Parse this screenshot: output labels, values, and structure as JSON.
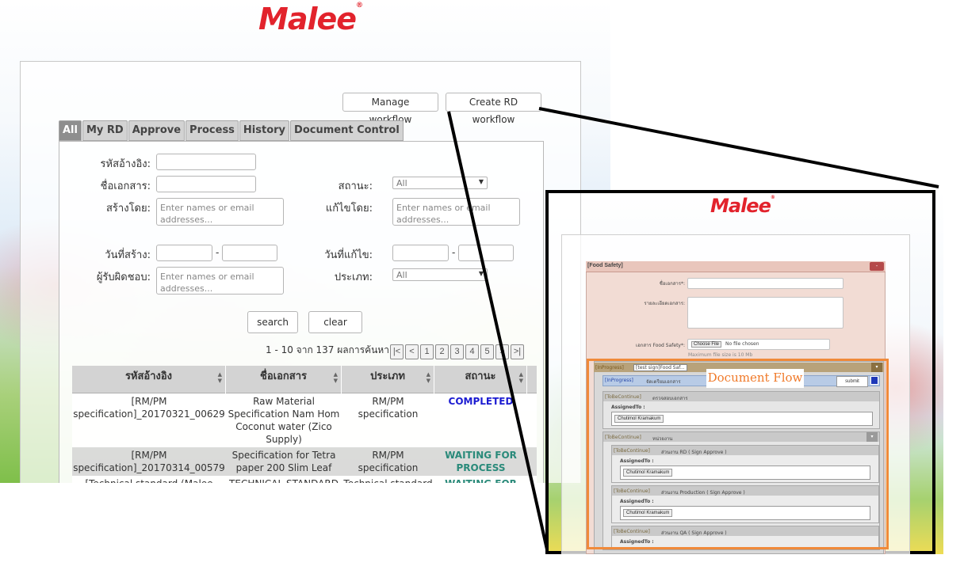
{
  "brand": {
    "logo_text": "Malee",
    "trademark": "®"
  },
  "toolbar": {
    "manage_workflow": "Manage workflow",
    "create_rd_workflow": "Create RD workflow"
  },
  "tabs": [
    "All",
    "My RD",
    "Approve",
    "Process",
    "History",
    "Document Control"
  ],
  "active_tab": "All",
  "filters": {
    "ref_label": "รหัสอ้างอิง:",
    "docname_label": "ชื่อเอกสาร:",
    "status_label": "สถานะ:",
    "status_value": "All",
    "created_by_label": "สร้างโดย:",
    "created_by_placeholder": "Enter names or email addresses...",
    "edited_by_label": "แก้ไขโดย:",
    "edited_by_placeholder": "Enter names or email addresses...",
    "created_date_label": "วันที่สร้าง:",
    "edited_date_label": "วันที่แก้ไข:",
    "responsible_label": "ผู้รับผิดชอบ:",
    "responsible_placeholder": "Enter names or email addresses...",
    "type_label": "ประเภท:",
    "type_value": "All",
    "range_sep": "-"
  },
  "actions": {
    "search": "search",
    "clear": "clear"
  },
  "pagination": {
    "info": "1 - 10 จาก 137 ผลการค้นหา",
    "buttons": [
      "|<",
      "<",
      "1",
      "2",
      "3",
      "4",
      "5",
      ">",
      ">|"
    ]
  },
  "table": {
    "columns": [
      "รหัสอ้างอิง",
      "ชื่อเอกสาร",
      "ประเภท",
      "สถานะ"
    ],
    "rows": [
      {
        "ref_lines": [
          "[RM/PM",
          "specification]_20170321_00629"
        ],
        "name_lines": [
          "Raw Material",
          "Specification Nam Hom",
          "Coconut water (Zico",
          "Supply)"
        ],
        "type": "RM/PM specification",
        "status_lines": [
          "COMPLETED"
        ],
        "status_kind": "completed"
      },
      {
        "ref_lines": [
          "[RM/PM",
          "specification]_20170314_00579"
        ],
        "name_lines": [
          "Specification for Tetra",
          "paper 200 Slim Leaf"
        ],
        "type": "RM/PM specification",
        "status_lines": [
          "WAITING FOR",
          "PROCESS"
        ],
        "status_kind": "waiting"
      },
      {
        "ref_lines": [
          "[Technical standard (Malee"
        ],
        "name_lines": [
          "TECHNICAL STANDARD"
        ],
        "type": "Technical standard",
        "status_lines": [
          "WAITING FOR"
        ],
        "status_kind": "waiting"
      }
    ]
  },
  "inset": {
    "panel_title": "[Food Safety]",
    "close": "-",
    "docname_label": "ชื่อเอกสาร*:",
    "detail_label": "รายละเอียดเอกสาร:",
    "file_label": "เอกสาร Food Safety*:",
    "choose_file": "Choose File",
    "no_file": "No file chosen",
    "max_size": "Maximum file size is 10 Mb",
    "flow_status": "[InProgress]",
    "flow_name": "[test sign]Food Saf...",
    "step0_status": "[InProgress]",
    "step0_title": "จัดเตรียมเอกสาร",
    "submit": "submit",
    "step1_status": "[ToBeContinue]",
    "step1_title": "ตรวจสอบเอกสาร",
    "assigned_to": "AssignedTo :",
    "assignee": "Chutimol Kramakum",
    "step2_status": "[ToBeContinue]",
    "step2_title": "หน่วยงาน",
    "sub1_status": "[ToBeContinue]",
    "sub1_title": "ส่วนงาน RD ( Sign Approve )",
    "sub2_status": "[ToBeContinue]",
    "sub2_title": "ส่วนงาน Production ( Sign Approve )",
    "sub3_status": "[ToBeContinue]",
    "sub3_title": "ส่วนงาน QA ( Sign Approve )"
  },
  "annotation": {
    "label": "Document Flow"
  },
  "colors": {
    "brand_red": "#e2232c",
    "completed": "#1b1bd1",
    "waiting": "#2a8a7a",
    "annotation_orange": "#f08a3a"
  }
}
